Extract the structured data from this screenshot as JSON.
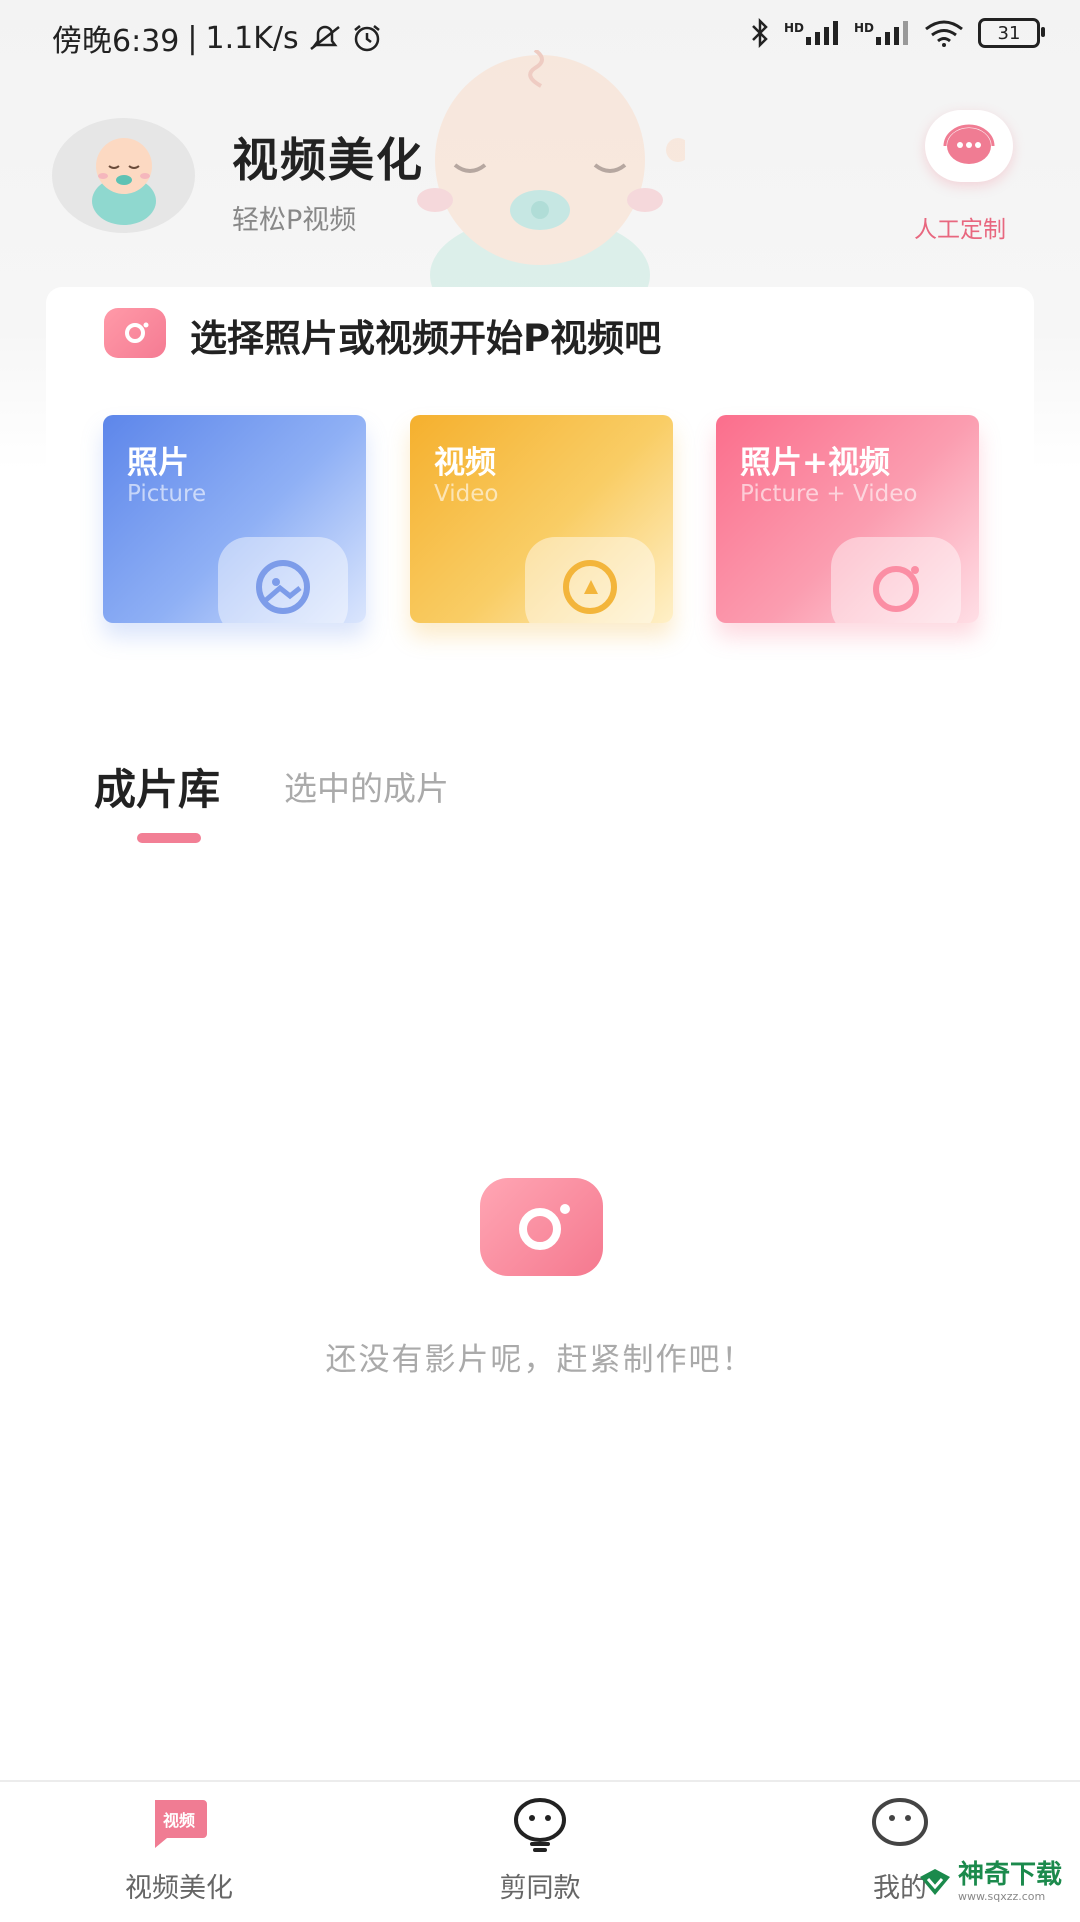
{
  "status_bar": {
    "time": "傍晚6:39",
    "network_speed": "1.1K/s",
    "signal_1_label": "HD",
    "signal_2_label": "HD",
    "battery": "31"
  },
  "header": {
    "title": "视频美化",
    "subtitle": "轻松P视频",
    "service_label": "人工定制"
  },
  "select_section": {
    "title": "选择照片或视频开始P视频吧",
    "cards": [
      {
        "label": "照片",
        "label_en": "Picture",
        "color": "#6a8ff0"
      },
      {
        "label": "视频",
        "label_en": "Video",
        "color": "#f7bb3d"
      },
      {
        "label": "照片+视频",
        "label_en": "Picture + Video",
        "color": "#fb7f9a"
      }
    ]
  },
  "tabs": [
    {
      "label": "成片库",
      "active": true
    },
    {
      "label": "选中的成片",
      "active": false
    }
  ],
  "empty_state": {
    "text": "还没有影片呢，赶紧制作吧！"
  },
  "bottom_nav": [
    {
      "label": "视频美化",
      "icon_text": "视频",
      "active": true
    },
    {
      "label": "剪同款",
      "active": false
    },
    {
      "label": "我的",
      "active": false
    }
  ],
  "watermark": {
    "text": "神奇下载",
    "url_text": "www.sqxzz.com"
  },
  "colors": {
    "accent": "#f27f95",
    "service": "#e8677f"
  }
}
